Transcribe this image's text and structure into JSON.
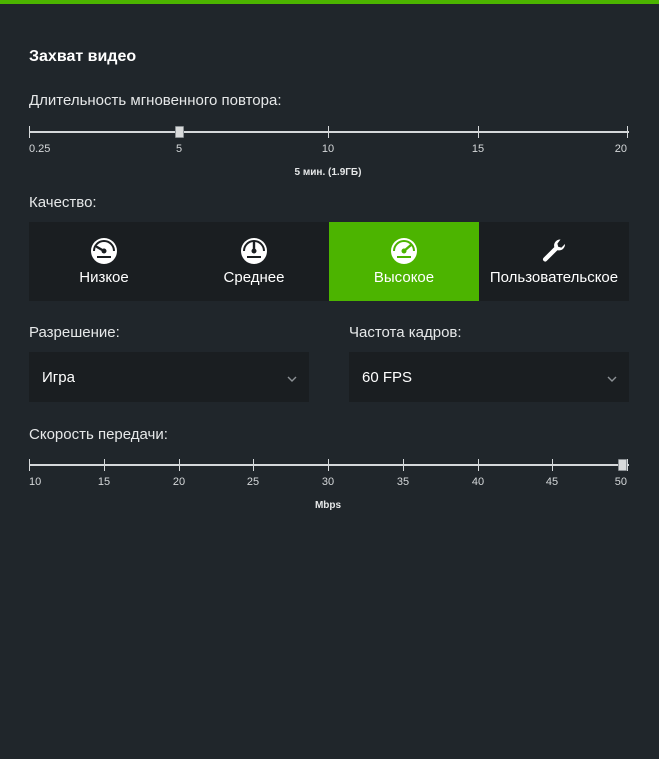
{
  "header": {
    "accent_color": "#4cb400"
  },
  "section": {
    "title": "Захват видео"
  },
  "replay": {
    "label": "Длительность мгновенного повтора:",
    "ticks": [
      "0.25",
      "5",
      "10",
      "15",
      "20"
    ],
    "min": 0.25,
    "max": 20,
    "value": 5,
    "value_text": "5 мин. (1.9ГБ)"
  },
  "quality": {
    "label": "Качество:",
    "options": [
      {
        "label": "Низкое",
        "icon": "gauge-low-icon"
      },
      {
        "label": "Среднее",
        "icon": "gauge-medium-icon"
      },
      {
        "label": "Высокое",
        "icon": "gauge-high-icon"
      },
      {
        "label": "Пользовательское",
        "icon": "wrench-icon"
      }
    ],
    "selected_index": 2
  },
  "resolution": {
    "label": "Разрешение:",
    "value": "Игра",
    "icon": "chevron-down-icon"
  },
  "framerate": {
    "label": "Частота кадров:",
    "value": "60 FPS",
    "icon": "chevron-down-icon"
  },
  "bitrate": {
    "label": "Скорость передачи:",
    "ticks": [
      "10",
      "15",
      "20",
      "25",
      "30",
      "35",
      "40",
      "45",
      "50"
    ],
    "min": 10,
    "max": 50,
    "value": 50,
    "unit": "Mbps"
  }
}
